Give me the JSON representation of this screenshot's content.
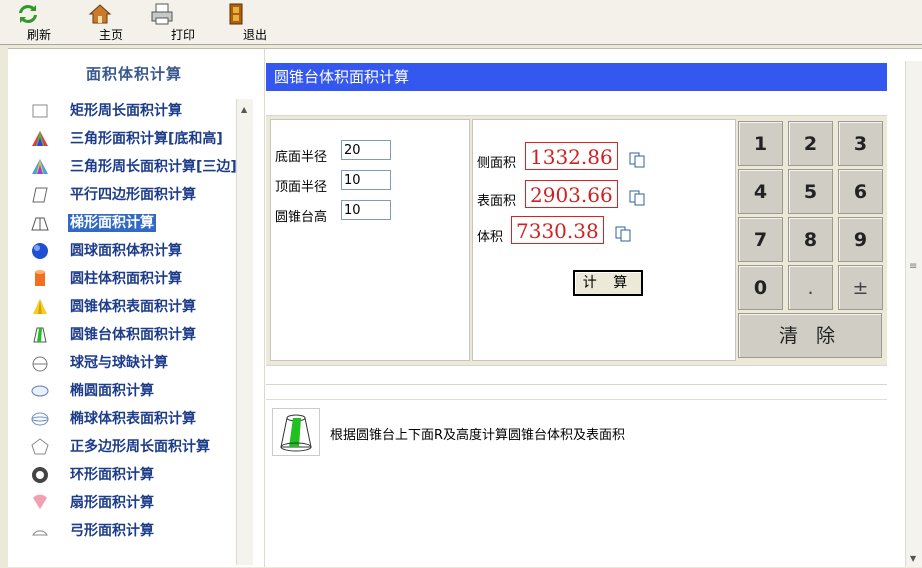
{
  "toolbar": {
    "refresh": "刷新",
    "home": "主页",
    "print": "打印",
    "exit": "退出"
  },
  "sidebar": {
    "title": "面积体积计算",
    "items": [
      {
        "label": "矩形周长面积计算",
        "icon": "rectangle-icon"
      },
      {
        "label": "三角形面积计算[底和高]",
        "icon": "triangle-icon"
      },
      {
        "label": "三角形周长面积计算[三边]",
        "icon": "triangle-sides-icon"
      },
      {
        "label": "平行四边形面积计算",
        "icon": "parallelogram-icon"
      },
      {
        "label": "梯形面积计算",
        "icon": "trapezoid-icon"
      },
      {
        "label": "圆球面积体积计算",
        "icon": "sphere-icon"
      },
      {
        "label": "圆柱体积面积计算",
        "icon": "cylinder-icon"
      },
      {
        "label": "圆锥体积表面积计算",
        "icon": "cone-icon"
      },
      {
        "label": "圆锥台体积面积计算",
        "icon": "frustum-icon"
      },
      {
        "label": "球冠与球缺计算",
        "icon": "spherical-cap-icon"
      },
      {
        "label": "椭圆面积计算",
        "icon": "ellipse-icon"
      },
      {
        "label": "椭球体积表面积计算",
        "icon": "ellipsoid-icon"
      },
      {
        "label": "正多边形周长面积计算",
        "icon": "polygon-icon"
      },
      {
        "label": "环形面积计算",
        "icon": "ring-icon"
      },
      {
        "label": "扇形面积计算",
        "icon": "sector-icon"
      },
      {
        "label": "弓形面积计算",
        "icon": "segment-icon"
      }
    ],
    "selected_index": 4
  },
  "main": {
    "title": "圆锥台体积面积计算",
    "inputs": {
      "bottom_radius": {
        "label": "底面半径",
        "value": "20"
      },
      "top_radius": {
        "label": "顶面半径",
        "value": "10"
      },
      "height": {
        "label": "圆锥台高",
        "value": "10"
      }
    },
    "outputs": {
      "lateral": {
        "label": "侧面积",
        "value": "1332.86"
      },
      "surface": {
        "label": "表面积",
        "value": "2903.66"
      },
      "volume": {
        "label": "体积",
        "value": "7330.38"
      }
    },
    "calc_button": "计 算",
    "keypad": {
      "keys": [
        "1",
        "2",
        "3",
        "4",
        "5",
        "6",
        "7",
        "8",
        "9",
        "0",
        ".",
        "±"
      ],
      "clear": "清 除"
    },
    "description": "根据圆锥台上下面R及高度计算圆锥台体积及表面积"
  },
  "colors": {
    "title_bar": "#3457f0",
    "sidebar_text": "#1d3d8a",
    "selected_bg": "#3169c6",
    "result_text": "#d22020"
  }
}
